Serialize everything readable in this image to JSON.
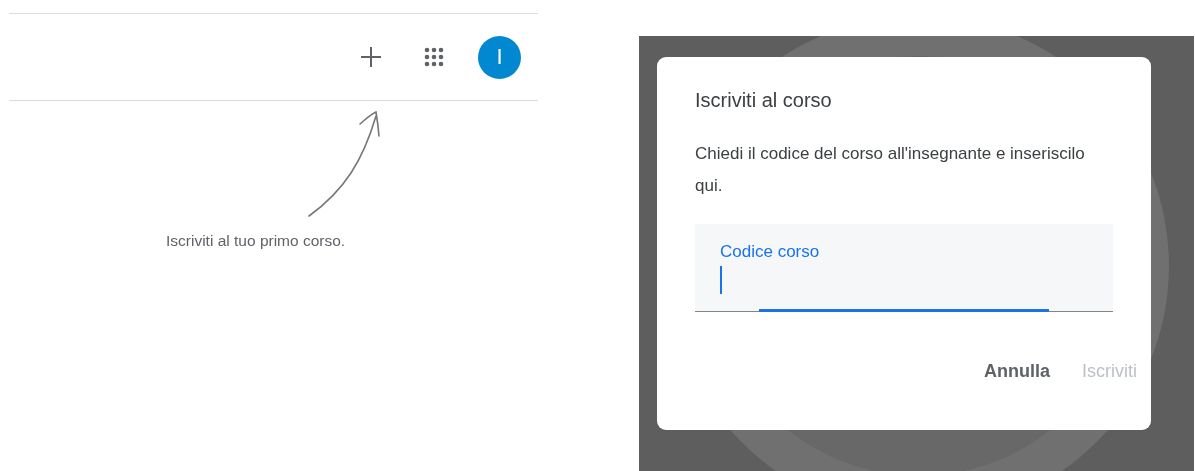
{
  "classroom": {
    "toolbar": {
      "avatar_letter": "I"
    },
    "empty_hint": "Iscriviti al tuo primo corso."
  },
  "join_dialog": {
    "title": "Iscriviti al corso",
    "body": "Chiedi il codice del corso all'insegnante e inseriscilo qui.",
    "field": {
      "label": "Codice corso",
      "focused": true
    },
    "buttons": [
      {
        "label": "Annulla",
        "disabled": false
      },
      {
        "label": "Iscriviti",
        "disabled": true
      }
    ]
  }
}
